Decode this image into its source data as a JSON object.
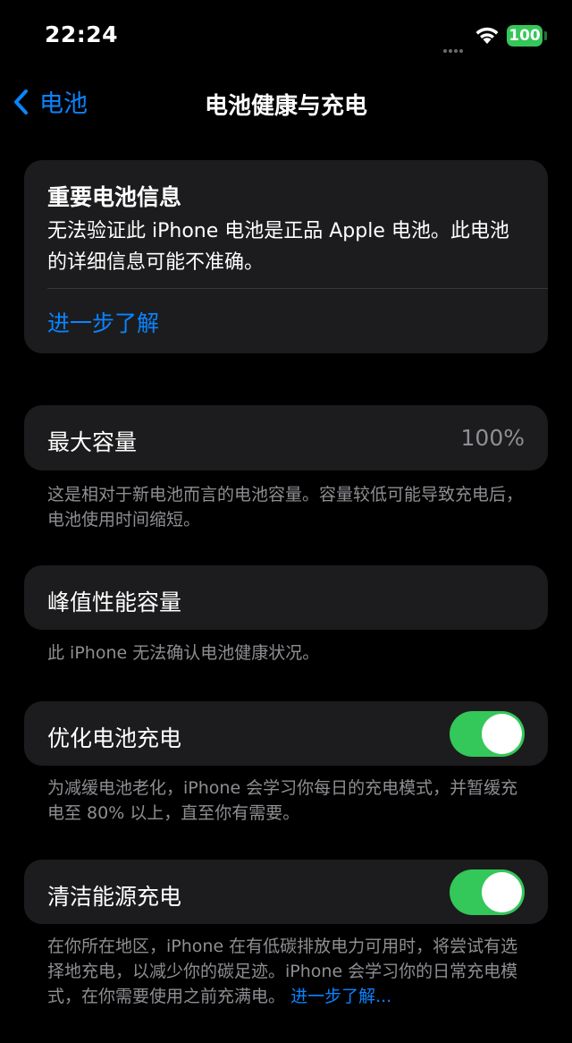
{
  "status_bar": {
    "time": "22:24",
    "battery": "100"
  },
  "nav": {
    "back_label": "电池",
    "title": "电池健康与充电"
  },
  "important_info": {
    "title": "重要电池信息",
    "body": "无法验证此 iPhone 电池是正品 Apple 电池。此电池的详细信息可能不准确。",
    "link": "进一步了解"
  },
  "max_capacity": {
    "label": "最大容量",
    "value": "100%",
    "footer": "这是相对于新电池而言的电池容量。容量较低可能导致充电后，电池使用时间缩短。"
  },
  "peak_performance": {
    "label": "峰值性能容量",
    "footer": "此 iPhone 无法确认电池健康状况。"
  },
  "optimized_charging": {
    "label": "优化电池充电",
    "enabled": true,
    "footer": "为减缓电池老化，iPhone 会学习你每日的充电模式，并暂缓充电至 80% 以上，直至你有需要。"
  },
  "clean_energy": {
    "label": "清洁能源充电",
    "enabled": true,
    "footer": "在你所在地区，iPhone 在有低碳排放电力可用时，将尝试有选择地充电，以减少你的碳足迹。iPhone 会学习你的日常充电模式，在你需要使用之前充满电。",
    "footer_link": "进一步了解..."
  },
  "colors": {
    "accent": "#0a84ff",
    "toggle_on": "#34c759",
    "card": "#1c1c1e",
    "secondary_text": "#8e8e93"
  }
}
